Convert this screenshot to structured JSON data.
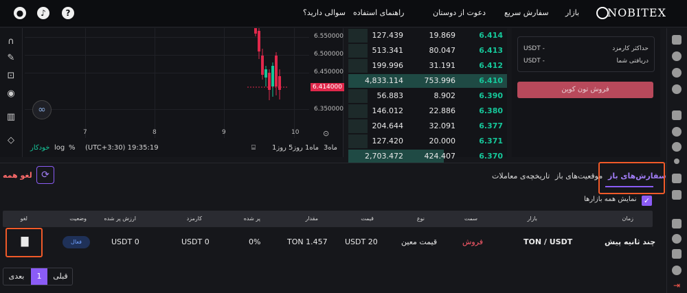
{
  "nav": {
    "brand": "NOBITEX",
    "items": [
      "بازار",
      "سفارش سریع",
      "دعوت از دوستان",
      "راهنمای استفاده",
      "سوالی دارید؟"
    ],
    "icons": [
      "help-icon",
      "notification-icon",
      "account-icon"
    ]
  },
  "chart": {
    "price_ticks": [
      "6.550000",
      "6.500000",
      "6.450000",
      "6.350000"
    ],
    "current_price": "6.414000",
    "x_ticks": [
      "7",
      "8",
      "9",
      "10"
    ],
    "footer": {
      "auto": "خودکار",
      "log": "log",
      "percent": "%",
      "timezone": "(UTC+3:30) 19:35:19",
      "ranges": [
        "1روز",
        "5روز",
        "1ماه",
        "3ماه"
      ]
    }
  },
  "orderbook": {
    "rows": [
      {
        "total": "127.439",
        "amount": "19.869",
        "price": "6.414",
        "depth": 0.12
      },
      {
        "total": "513.341",
        "amount": "80.047",
        "price": "6.413",
        "depth": 0.12
      },
      {
        "total": "199.996",
        "amount": "31.191",
        "price": "6.412",
        "depth": 0.12
      },
      {
        "total": "4,833.114",
        "amount": "753.996",
        "price": "6.410",
        "depth": 1.0
      },
      {
        "total": "56.883",
        "amount": "8.902",
        "price": "6.390",
        "depth": 0.12
      },
      {
        "total": "146.012",
        "amount": "22.886",
        "price": "6.380",
        "depth": 0.12
      },
      {
        "total": "204.644",
        "amount": "32.091",
        "price": "6.377",
        "depth": 0.12
      },
      {
        "total": "127.420",
        "amount": "20.000",
        "price": "6.371",
        "depth": 0.12
      },
      {
        "total": "2,703.472",
        "amount": "424.407",
        "price": "6.370",
        "depth": 0.6
      }
    ]
  },
  "trade": {
    "fee_label": "حداکثر کارمزد",
    "receive_label": "دریافتی شما",
    "fee_value": "USDT  -",
    "receive_value": "USDT  -",
    "sell_button": "فروش تون کوین"
  },
  "bottom": {
    "tabs": [
      "سفارش‌های باز",
      "موقعیت‌های باز",
      "تاریخچه‌ی معاملات"
    ],
    "cancel_all": "لغو همه",
    "show_all_markets": "نمایش همه بازارها",
    "headers": [
      "زمان",
      "بازار",
      "سمت",
      "نوع",
      "قیمت",
      "مقدار",
      "پر شده",
      "کارمزد",
      "ارزش پر شده",
      "وضعیت",
      "لغو"
    ],
    "row": {
      "time": "چند ثانیه پیش",
      "market": "TON / USDT",
      "side": "فروش",
      "type": "قیمت معین",
      "price": "USDT  20",
      "amount": "TON  1.457",
      "filled": "0%",
      "fee": "USDT  0",
      "filled_value": "USDT  0",
      "status": "فعال"
    },
    "pager": {
      "prev": "قبلی",
      "page": "1",
      "next": "بعدی"
    }
  },
  "colors": {
    "accent": "#8b5cf6",
    "buy": "#16c79a",
    "sell": "#e0284b",
    "highlight": "#f15a29"
  }
}
